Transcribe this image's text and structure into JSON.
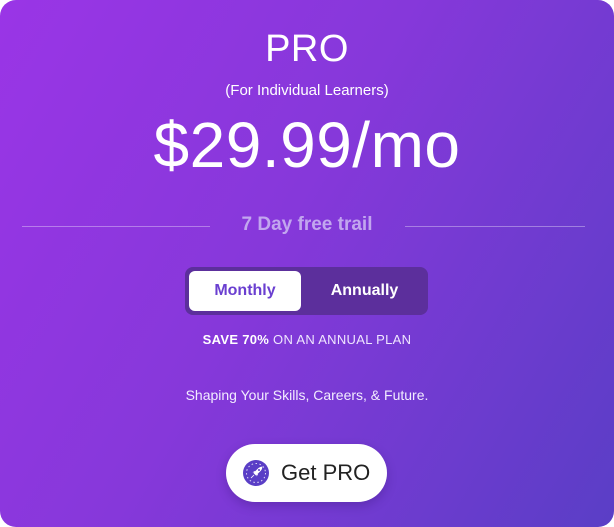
{
  "plan": {
    "name": "PRO",
    "subtitle": "(For Individual Learners)",
    "price": "$29.99/mo",
    "trial": "7 Day free trail"
  },
  "billing_toggle": {
    "options": [
      "Monthly",
      "Annually"
    ],
    "selected": "Monthly"
  },
  "savings": {
    "bold": "SAVE 70%",
    "rest": " ON AN ANNUAL PLAN"
  },
  "tagline": "Shaping Your Skills, Careers, & Future.",
  "cta": {
    "label": "Get PRO",
    "icon": "rocket-icon"
  },
  "colors": {
    "gradient_start": "#9a35e6",
    "gradient_end": "#5a3ec6",
    "toggle_track": "#5c2f9c",
    "selected_text": "#6a3fd0",
    "trial_text": "#c2a6ef"
  }
}
